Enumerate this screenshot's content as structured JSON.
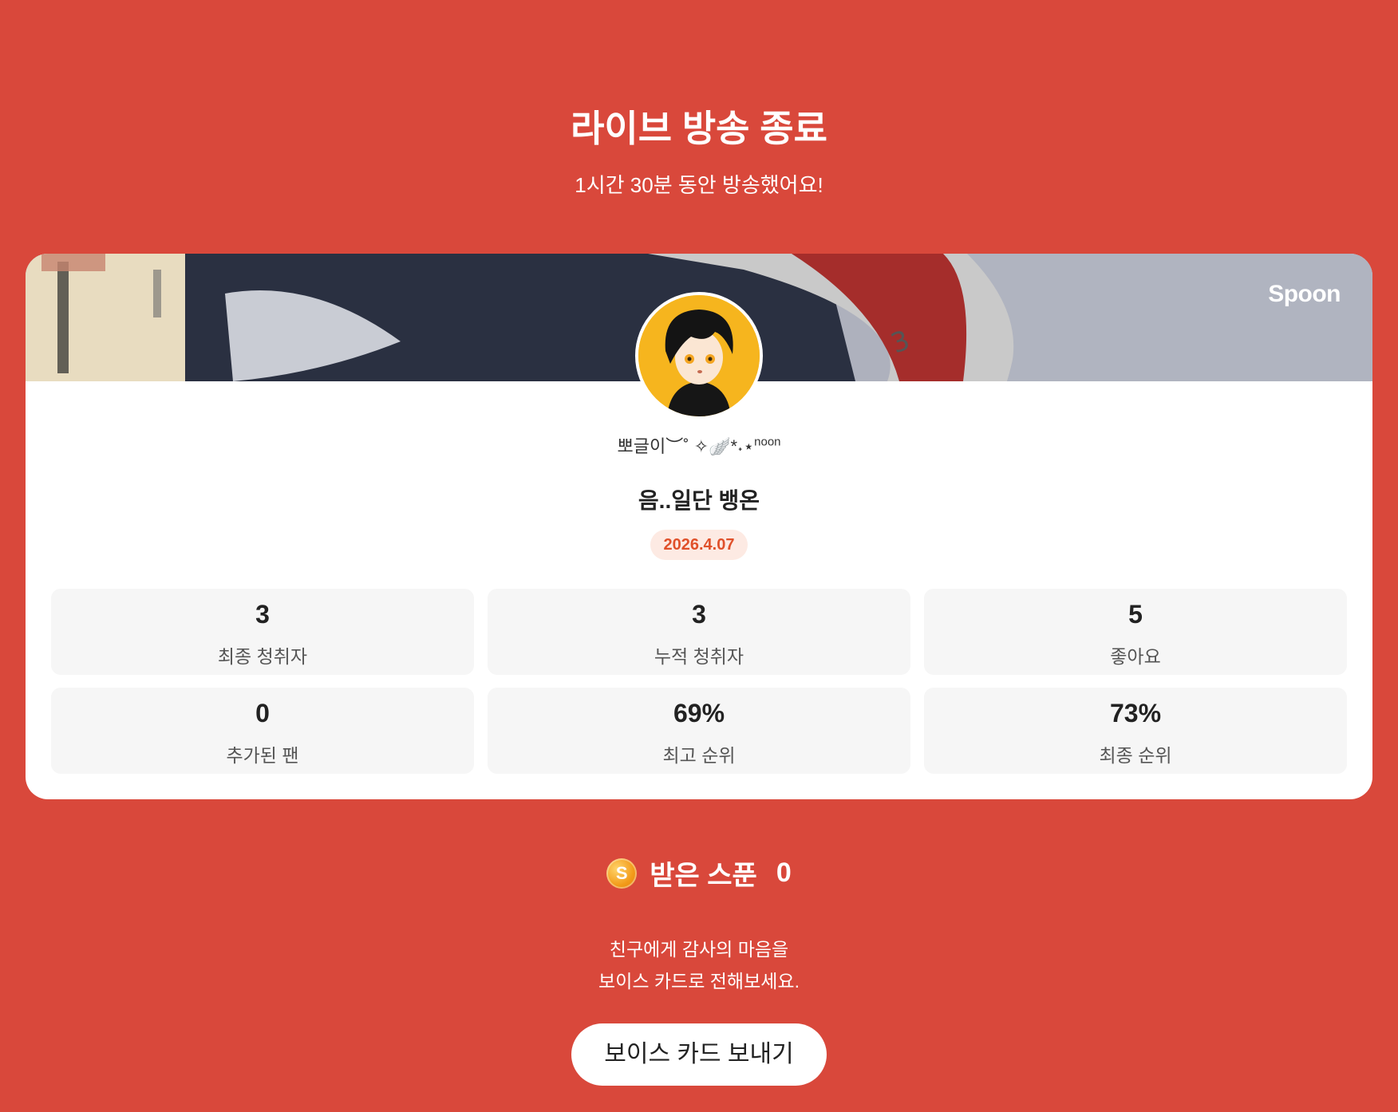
{
  "header": {
    "title": "라이브 방송 종료",
    "subtitle": "1시간 30분 동안 방송했어요!"
  },
  "card": {
    "brand": "Spoon",
    "username": "뽀글이︶˚ ✧🪽*˖⋆",
    "username_sup": "noon",
    "room_title": "음..일단 뱅온",
    "date": "2026.4.07",
    "stats": [
      {
        "value": "3",
        "label": "최종 청취자"
      },
      {
        "value": "3",
        "label": "누적 청취자"
      },
      {
        "value": "5",
        "label": "좋아요"
      },
      {
        "value": "0",
        "label": "추가된 팬"
      },
      {
        "value": "69%",
        "label": "최고 순위"
      },
      {
        "value": "73%",
        "label": "최종 순위"
      }
    ]
  },
  "spoon": {
    "coin_letter": "S",
    "label": "받은 스푼",
    "count": "0"
  },
  "thanks": {
    "line1": "친구에게 감사의 마음을",
    "line2": "보이스 카드로 전해보세요."
  },
  "send_button": {
    "label": "보이스 카드 보내기"
  },
  "colors": {
    "background": "#d9483b",
    "badge_bg": "#fdeae3",
    "badge_text": "#e0502a"
  }
}
